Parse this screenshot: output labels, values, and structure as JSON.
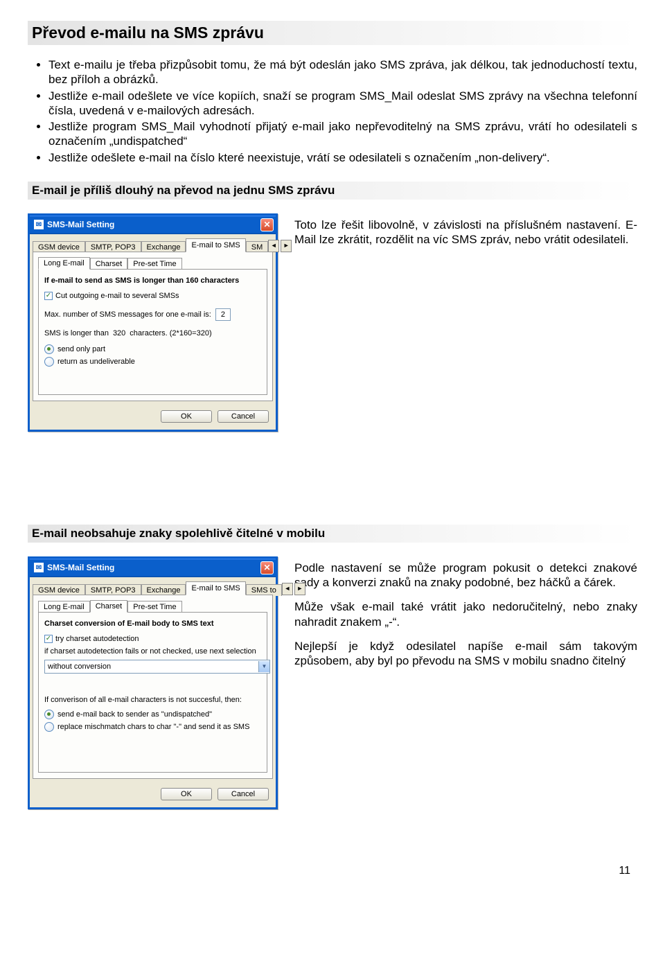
{
  "heading_main": "Převod e-mailu na SMS zprávu",
  "bullets": [
    "Text e-mailu je třeba přizpůsobit tomu, že má být odeslán jako SMS zpráva, jak délkou, tak jednoduchostí textu, bez příloh a obrázků.",
    "Jestliže e-mail odešlete ve více kopiích, snaží se program SMS_Mail odeslat  SMS zprávy na všechna telefonní čísla, uvedená v e-mailových adresách.",
    "Jestliže program SMS_Mail vyhodnotí přijatý e-mail jako nepřevoditelný na SMS zprávu, vrátí ho odesilateli s označením „undispatched“",
    "Jestliže odešlete e-mail na číslo které neexistuje, vrátí se odesilateli s označením „non-delivery“."
  ],
  "subheading_1": "E-mail je příliš dlouhý na převod na jednu SMS zprávu",
  "subheading_2": "E-mail neobsahuje znaky spolehlivě čitelné v mobilu",
  "paragraph_1": "Toto lze řešit libovolně, v závislosti na příslušném nastavení. E-Mail lze zkrátit, rozdělit na víc SMS zpráv, nebo vrátit odesilateli.",
  "paragraph_2a": "Podle nastavení se může program pokusit o detekci znakové sady a konverzi znaků na znaky podobné, bez háčků a čárek.",
  "paragraph_2b": "Může však e-mail také vrátit jako nedoručitelný, nebo znaky nahradit znakem „-“.",
  "paragraph_2c": "Nejlepší je když odesilatel napíše e-mail sám takovým způsobem, aby byl po převodu na SMS v mobilu snadno čitelný",
  "page_number": "11",
  "dlg": {
    "title": "SMS-Mail Setting",
    "tabs": {
      "gsm": "GSM device",
      "smtp": "SMTP, POP3",
      "exchange": "Exchange",
      "emailtosms": "E-mail to SMS",
      "smsto_partial": "SM",
      "smsto_full": "SMS to"
    },
    "arrows": {
      "left": "◄",
      "right": "►"
    },
    "subtabs": {
      "long": "Long E-mail",
      "charset": "Charset",
      "preset": "Pre-set Time"
    },
    "long_panel": {
      "bold": "If e-mail to send as SMS is longer than 160 characters",
      "cb_cut": "Cut outgoing e-mail to several SMSs",
      "max_label_a": "Max. number of SMS messages for one e-mail is:",
      "max_value": "2",
      "longer_a": "SMS is longer than",
      "longer_val": "320",
      "longer_b": "characters.  (2*160=320)",
      "r_sendpart": "send only part",
      "r_undeliv": "return as undeliverable"
    },
    "charset_panel": {
      "bold": "Charset conversion of E-mail body to SMS text",
      "cb_try": "try charset autodetection",
      "line2": "if charset autodetection fails or not checked, use next selection",
      "dd_value": "without conversion",
      "line3": "If converison of all e-mail characters is not succesful, then:",
      "r_back": "send e-mail back to sender as \"undispatched\"",
      "r_replace": "replace mischmatch chars to char \"-\" and send it as SMS"
    },
    "buttons": {
      "ok": "OK",
      "cancel": "Cancel"
    }
  }
}
